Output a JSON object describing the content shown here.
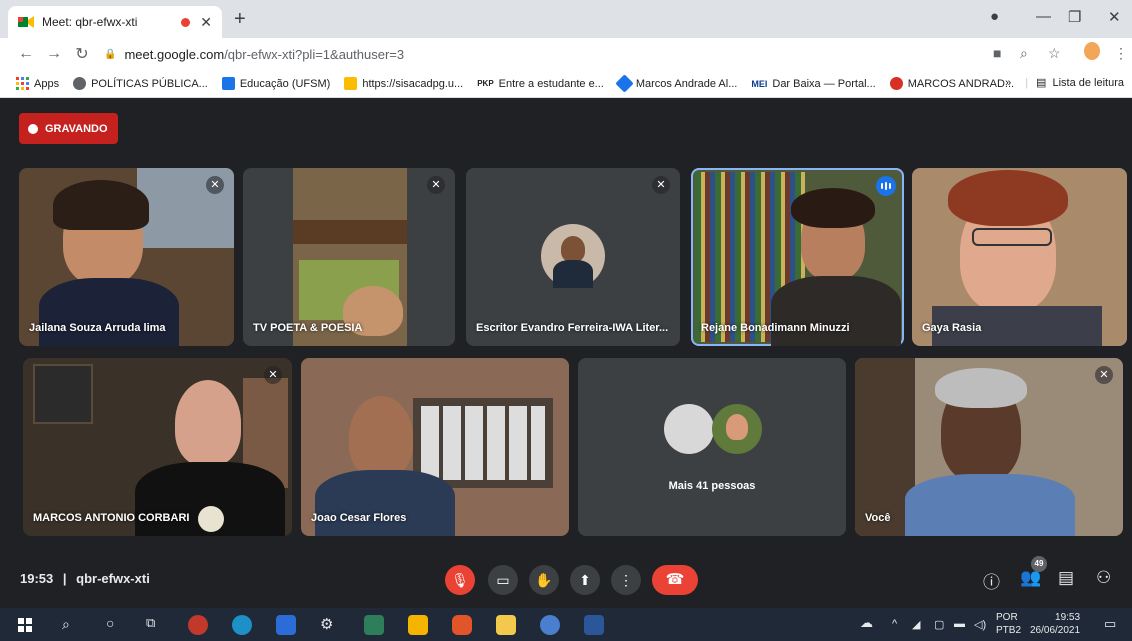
{
  "browser": {
    "tab_title": "Meet: qbr-efwx-xti",
    "url_host": "meet.google.com",
    "url_path": "/qbr-efwx-xti?pli=1&authuser=3"
  },
  "bookmarks": {
    "apps": "Apps",
    "items": [
      "POLÍTICAS PÚBLICA...",
      "Educação (UFSM)",
      "https://sisacadpg.u...",
      "Entre a estudante e...",
      "Marcos Andrade Al...",
      "Dar Baixa — Portal...",
      "MARCOS ANDRAD..."
    ],
    "prefixes": [
      "PKP",
      "MEI"
    ],
    "reading_list": "Lista de leitura",
    "more": "»"
  },
  "meet": {
    "recording_label": "GRAVANDO",
    "time": "19:53",
    "separator": "|",
    "meeting_code": "qbr-efwx-xti",
    "participant_count": "49",
    "participants": [
      "Jailana Souza Arruda lima",
      "TV POETA & POESIA",
      "Escritor Evandro Ferreira-IWA Liter...",
      "Rejane Bonadimann Minuzzi",
      "Gaya Rasia",
      "MARCOS ANTONIO CORBARI",
      "Joao Cesar Flores",
      "Mais 41 pessoas",
      "Você"
    ]
  },
  "taskbar": {
    "language": "POR",
    "layout": "PTB2",
    "time": "19:53",
    "date": "26/06/2021"
  }
}
